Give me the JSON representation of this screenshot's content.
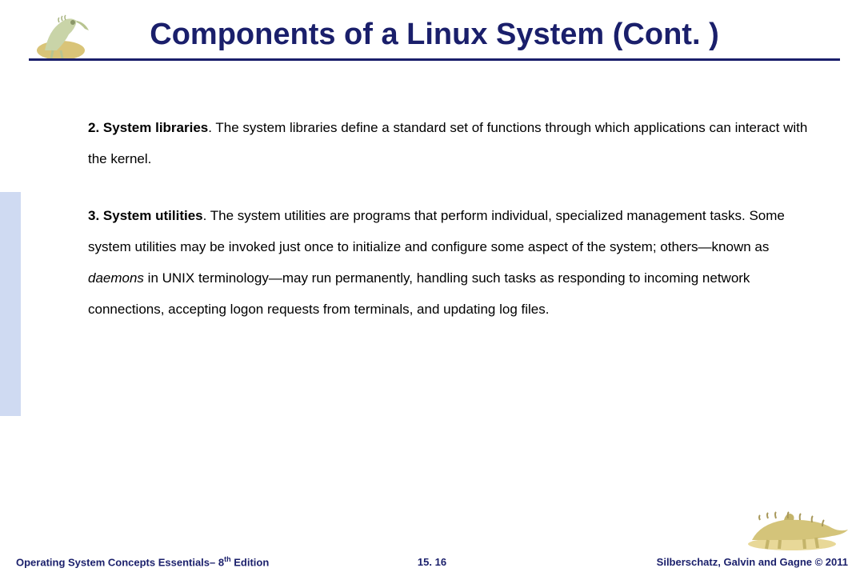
{
  "title": "Components of a Linux System (Cont. )",
  "para1": {
    "lead": "2. System libraries",
    "rest": ". The system libraries define a standard set of functions through which applications can interact with the kernel."
  },
  "para2": {
    "lead": "3. System utilities",
    "part1": ". The system utilities are programs that perform individual, specialized management tasks. Some system utilities may be invoked just once to initialize and configure some aspect of the system; others—known as ",
    "italic": "daemons",
    "part2": " in UNIX terminology—may run permanently, handling such tasks as responding to incoming network connections, accepting logon requests from terminals, and updating log files."
  },
  "footer": {
    "left_a": "Operating System Concepts Essentials– 8",
    "left_sup": "th",
    "left_b": " Edition",
    "center": "15. 16",
    "right": "Silberschatz, Galvin and Gagne © 2011"
  }
}
